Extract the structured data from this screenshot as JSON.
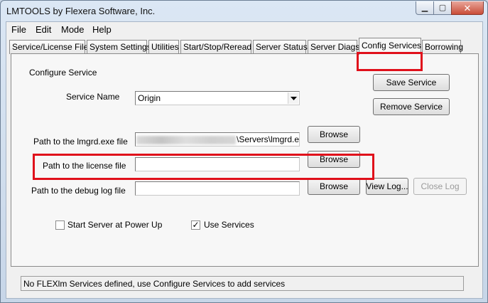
{
  "window": {
    "title": "LMTOOLS by Flexera Software, Inc.",
    "min_glyph": "▁",
    "max_glyph": "▢",
    "close_glyph": "✕"
  },
  "menu": [
    "File",
    "Edit",
    "Mode",
    "Help"
  ],
  "tabs": [
    {
      "label": "Service/License File",
      "active": false
    },
    {
      "label": "System Settings",
      "active": false
    },
    {
      "label": "Utilities",
      "active": false
    },
    {
      "label": "Start/Stop/Reread",
      "active": false
    },
    {
      "label": "Server Status",
      "active": false
    },
    {
      "label": "Server Diags",
      "active": false
    },
    {
      "label": "Config Services",
      "active": true
    },
    {
      "label": "Borrowing",
      "active": false
    }
  ],
  "config": {
    "section_label": "Configure Service",
    "service_name_label": "Service Name",
    "service_name_value": "Origin",
    "lmgrd_path_label": "Path to the lmgrd.exe file",
    "lmgrd_path_value": "\\Servers\\lmgrd.exe",
    "license_path_label": "Path to the license file",
    "license_path_value": "",
    "debug_log_label": "Path to the debug log file",
    "debug_log_value": "",
    "save_service": "Save Service",
    "remove_service": "Remove Service",
    "browse": "Browse",
    "view_log": "View Log...",
    "close_log": "Close Log",
    "start_at_power_up": {
      "label": "Start Server at Power Up",
      "checked": false
    },
    "use_services": {
      "label": "Use Services",
      "checked": true
    }
  },
  "status": "No FLEXlm Services defined, use Configure Services to add services",
  "colors": {
    "highlight": "#e0101b",
    "window_frame": "#c9d6e6"
  }
}
